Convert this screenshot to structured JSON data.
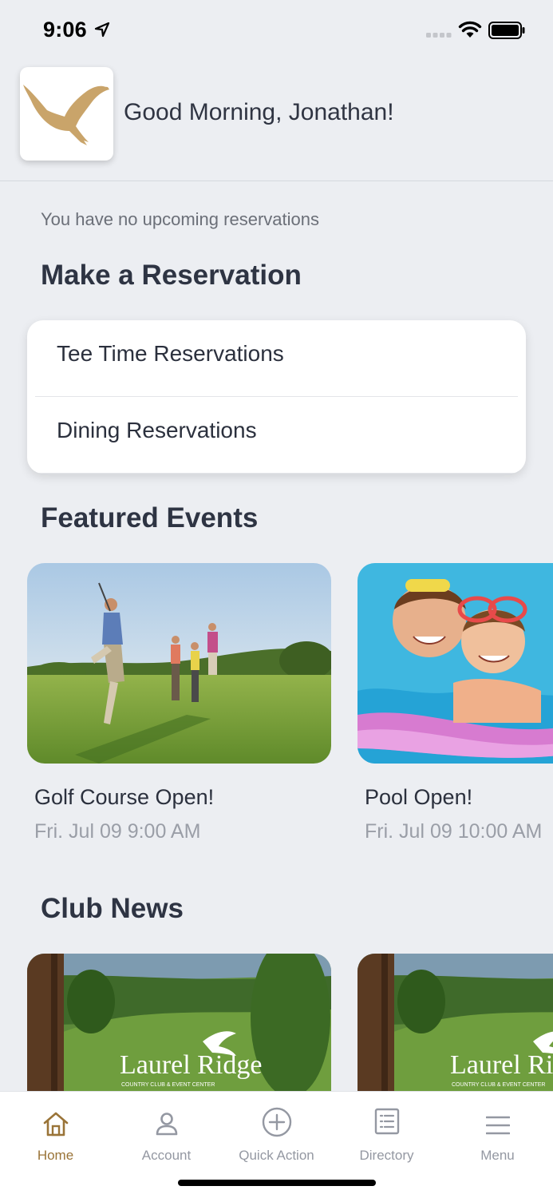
{
  "status_bar": {
    "time": "9:06"
  },
  "header": {
    "greeting": "Good Morning, Jonathan!",
    "logo_icon": "eagle-logo-icon"
  },
  "reservations": {
    "empty_message": "You have no upcoming reservations",
    "section_title": "Make a Reservation",
    "items": [
      {
        "label": "Tee Time Reservations"
      },
      {
        "label": "Dining Reservations"
      }
    ]
  },
  "events": {
    "section_title": "Featured Events",
    "items": [
      {
        "title": "Golf Course Open!",
        "date": "Fri. Jul 09 9:00 AM"
      },
      {
        "title": "Pool Open!",
        "date": "Fri. Jul 09 10:00 AM"
      }
    ]
  },
  "news": {
    "section_title": "Club News",
    "items": [
      {
        "image_text": "Laurel Ridge",
        "image_subtext": "COUNTRY CLUB & EVENT CENTER"
      },
      {
        "image_text": "Laurel Ridge",
        "image_subtext": "COUNTRY CLUB & EVENT CENTER"
      }
    ]
  },
  "tab_bar": {
    "items": [
      {
        "label": "Home",
        "icon": "home-icon",
        "active": true
      },
      {
        "label": "Account",
        "icon": "person-icon",
        "active": false
      },
      {
        "label": "Quick Action",
        "icon": "plus-circle-icon",
        "active": false
      },
      {
        "label": "Directory",
        "icon": "list-icon",
        "active": false
      },
      {
        "label": "Menu",
        "icon": "hamburger-icon",
        "active": false
      }
    ]
  },
  "colors": {
    "background": "#eceef2",
    "accent": "#9a7438",
    "text_primary": "#2e3443",
    "text_muted": "#9a9ea7"
  }
}
